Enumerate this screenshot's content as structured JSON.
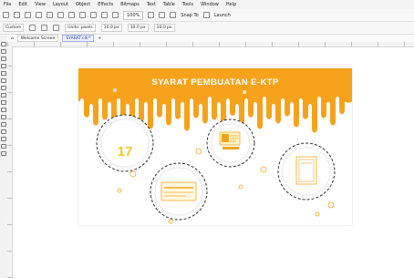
{
  "menu": [
    "File",
    "Edit",
    "View",
    "Layout",
    "Object",
    "Effects",
    "Bitmaps",
    "Text",
    "Table",
    "Tools",
    "Window",
    "Help"
  ],
  "toolbar": {
    "zoom": "100%",
    "snap_to": "Snap To",
    "launch": "Launch"
  },
  "propbar": {
    "preset": "Custom",
    "units": "Units: pixels",
    "nudge": "10.0 px",
    "dup1": "10.0 px",
    "dup2": "10.0 px"
  },
  "tabs": [
    {
      "label": "Welcome Screen"
    },
    {
      "label": "SYARAT.cdr*"
    }
  ],
  "artboard": {
    "title": "SYARAT PEMBUATAN E-KTP",
    "number": "17"
  },
  "colors": {
    "accent": "#F6A21C",
    "number": "#F7C722",
    "background": "#FFFFFF"
  }
}
